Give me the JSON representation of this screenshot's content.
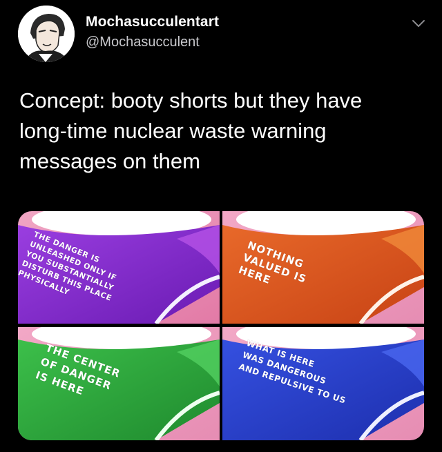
{
  "user": {
    "display_name": "Mochasucculentart",
    "handle": "@Mochasucculent"
  },
  "tweet": {
    "text": "Concept: booty shorts but they have\nlong-time nuclear waste warning\nmessages on them"
  },
  "media": {
    "panels": [
      {
        "color": "#7a22c9",
        "text": "The danger is\nunleashed only if\nyou substantially\ndisturb this place\nphysically"
      },
      {
        "color": "#d6561a",
        "text": "Nothing\nvalued is\nhere"
      },
      {
        "color": "#2aa63a",
        "text": "The center\nof danger\nis here"
      },
      {
        "color": "#2740c8",
        "text": "What is here\nwas dangerous\nand repulsive to us"
      }
    ]
  }
}
